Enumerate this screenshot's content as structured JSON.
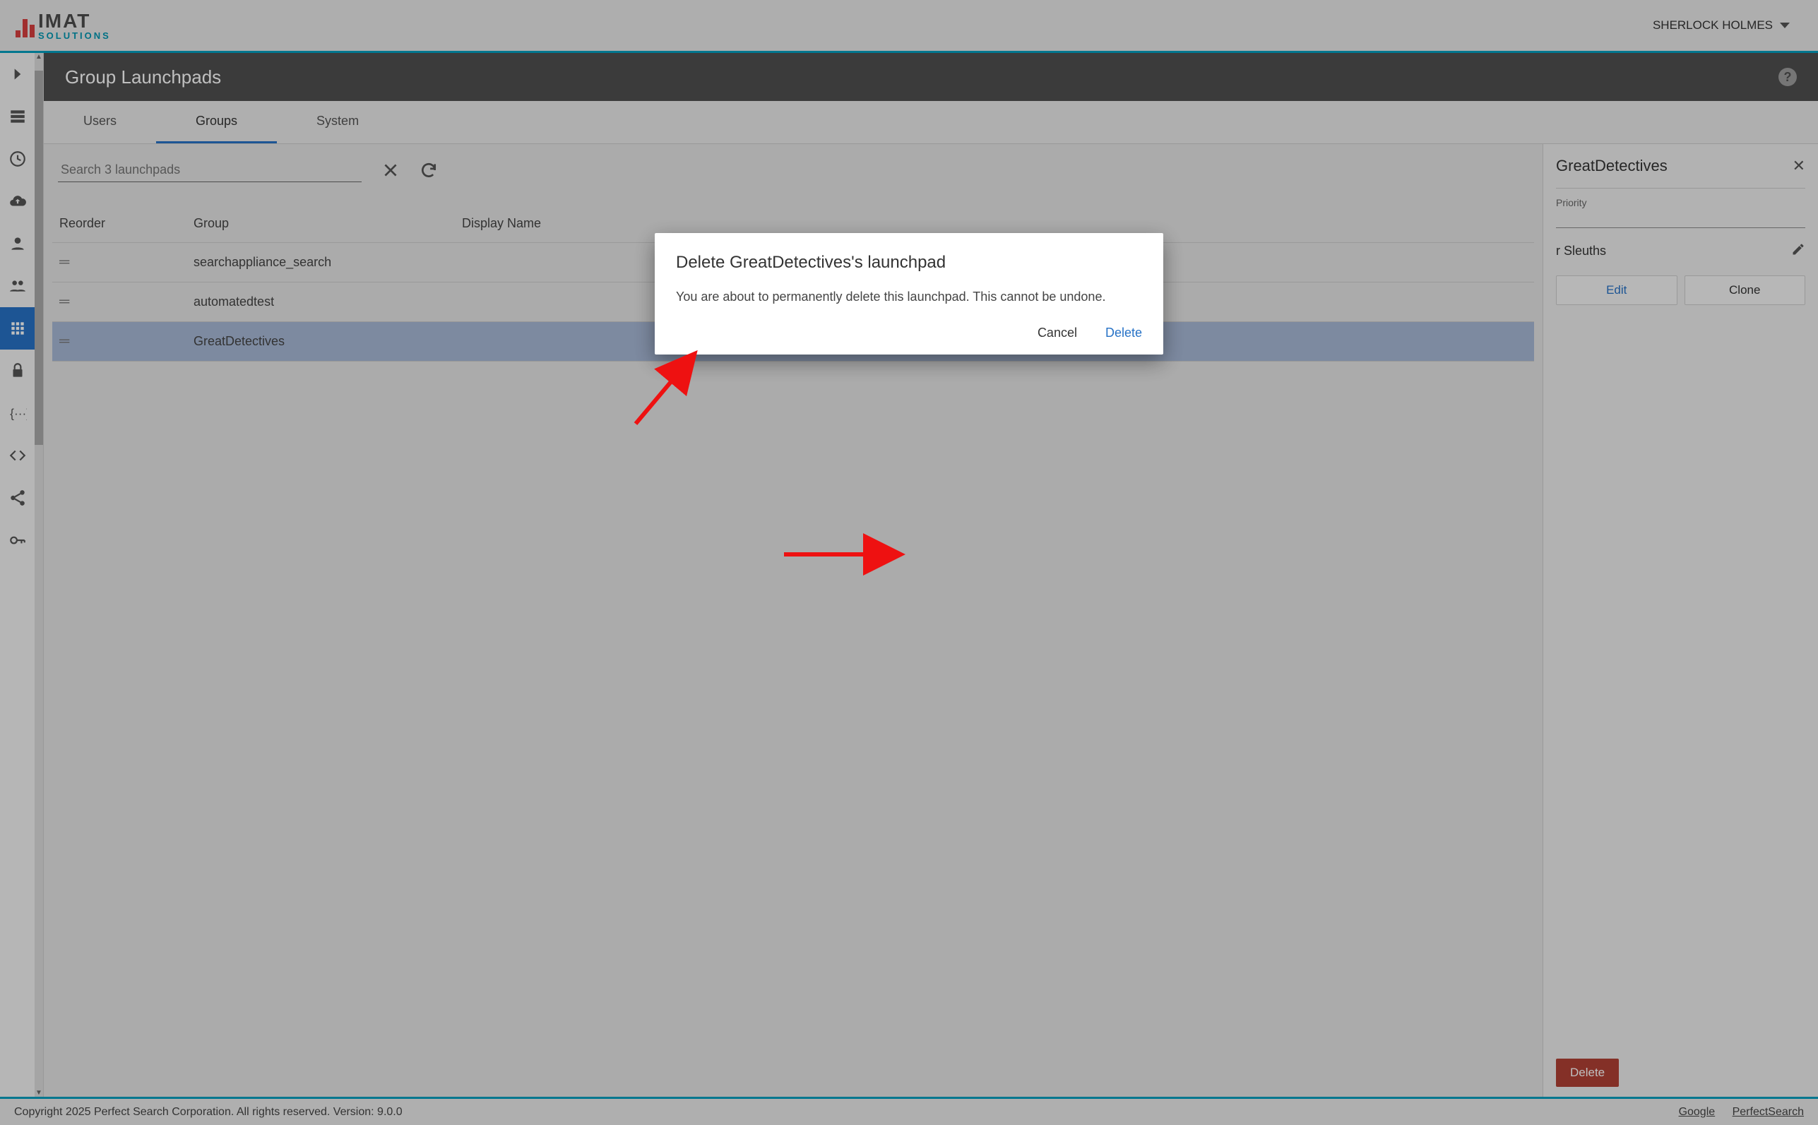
{
  "brand": {
    "main": "IMAT",
    "sub": "SOLUTIONS"
  },
  "user_name": "SHERLOCK HOLMES",
  "page_title": "Group Launchpads",
  "tabs": {
    "users": "Users",
    "groups": "Groups",
    "system": "System"
  },
  "search": {
    "placeholder": "Search 3 launchpads"
  },
  "columns": {
    "reorder": "Reorder",
    "group": "Group",
    "display_name": "Display Name"
  },
  "rows": [
    {
      "group": "searchappliance_search"
    },
    {
      "group": "automatedtest"
    },
    {
      "group": "GreatDetectives"
    }
  ],
  "detail": {
    "title": "GreatDetectives",
    "priority_label": "Priority",
    "display_name_value": "r Sleuths",
    "edit": "Edit",
    "clone": "Clone",
    "delete": "Delete"
  },
  "modal": {
    "title": "Delete GreatDetectives's launchpad",
    "body": "You are about to permanently delete this launchpad. This cannot be undone.",
    "cancel": "Cancel",
    "confirm": "Delete"
  },
  "footer": {
    "copyright": "Copyright 2025 Perfect Search Corporation. All rights reserved. Version: 9.0.0",
    "link1": "Google",
    "link2": "PerfectSearch"
  }
}
